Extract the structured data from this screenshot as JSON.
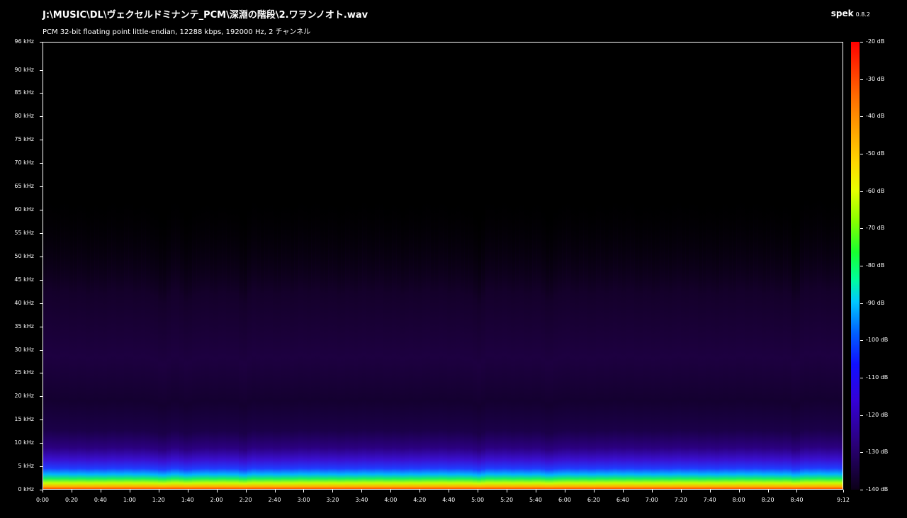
{
  "header": {
    "file_path": "J:\\MUSIC\\DL\\ヴェクセルドミナンテ_PCM\\深淵の階段\\2.ワヲンノオト.wav",
    "file_info": "PCM 32-bit floating point little-endian, 12288 kbps, 192000 Hz, 2 チャンネル",
    "app_name": "spek",
    "app_version": "0.8.2"
  },
  "chart_data": {
    "type": "heatmap",
    "title": "",
    "xlabel": "",
    "ylabel": "",
    "x_range_seconds": [
      0,
      552
    ],
    "y_range_khz": [
      0,
      96
    ],
    "x_ticks": [
      "0:00",
      "0:20",
      "0:40",
      "1:00",
      "1:20",
      "1:40",
      "2:00",
      "2:20",
      "2:40",
      "3:00",
      "3:20",
      "3:40",
      "4:00",
      "4:20",
      "4:40",
      "5:00",
      "5:20",
      "5:40",
      "6:00",
      "6:20",
      "6:40",
      "7:00",
      "7:20",
      "7:40",
      "8:00",
      "8:20",
      "8:40",
      "9:12"
    ],
    "y_ticks": [
      "96 kHz",
      "90 kHz",
      "85 kHz",
      "80 kHz",
      "75 kHz",
      "70 kHz",
      "65 kHz",
      "60 kHz",
      "55 kHz",
      "50 kHz",
      "45 kHz",
      "40 kHz",
      "35 kHz",
      "30 kHz",
      "25 kHz",
      "20 kHz",
      "15 kHz",
      "10 kHz",
      "5 kHz",
      "0 kHz"
    ],
    "y_tick_values_khz": [
      96,
      90,
      85,
      80,
      75,
      70,
      65,
      60,
      55,
      50,
      45,
      40,
      35,
      30,
      25,
      20,
      15,
      10,
      5,
      0
    ],
    "colorbar_labels": [
      "-20 dB",
      "-30 dB",
      "-40 dB",
      "-50 dB",
      "-60 dB",
      "-70 dB",
      "-80 dB",
      "-90 dB",
      "-100 dB",
      "-110 dB",
      "-120 dB",
      "-130 dB",
      "-140 dB"
    ],
    "colorbar_range_db": [
      -140,
      -20
    ],
    "energy_cutoff_khz": 63,
    "dips_seconds": [
      82,
      100,
      138,
      300,
      350,
      520
    ]
  }
}
